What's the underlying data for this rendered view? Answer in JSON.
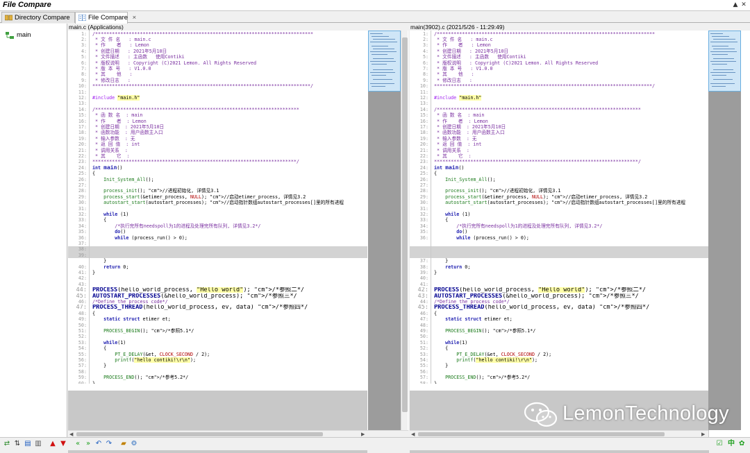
{
  "app": {
    "title": "File Compare"
  },
  "tabs": [
    {
      "label": "Directory Compare",
      "active": false
    },
    {
      "label": "File Compare",
      "active": true,
      "close": "×"
    }
  ],
  "tree": {
    "root_label": "main"
  },
  "left_pane": {
    "header": "main.c (Applications)"
  },
  "right_pane": {
    "header": "main(3902).c (2021/5/26 - 11:29:49)"
  },
  "watermark": {
    "text": "LemonTechnology"
  },
  "status": {
    "lang_left": "中",
    "lang_right": "✿"
  },
  "colors": {
    "keyword": "#1f1fb0",
    "comment": "#7a2fa0",
    "string_bg": "#ffffa8",
    "changed_row": "#d3d3d3"
  },
  "icons": [
    "directory-compare-icon",
    "file-compare-icon",
    "folder-tree-icon",
    "swap-icon",
    "sync-icon",
    "copy-left-icon",
    "copy-right-icon",
    "prev-diff-icon",
    "next-diff-icon",
    "first-diff-icon",
    "last-diff-icon",
    "undo-icon",
    "redo-icon",
    "open-folder-icon",
    "settings-icon"
  ],
  "left_lines": [
    {
      "n": "1",
      "t": "/******************************************************************************",
      "c": "cm"
    },
    {
      "n": "2",
      "t": " * 文 件 名   : main.c",
      "c": "cm"
    },
    {
      "n": "3",
      "t": " * 作    者   : Lemon",
      "c": "cm"
    },
    {
      "n": "4",
      "t": " * 创建日期   : 2021年5月10日",
      "c": "cm"
    },
    {
      "n": "5",
      "t": " * 文件描述   : 主函数   使用Contiki",
      "c": "cm"
    },
    {
      "n": "6",
      "t": " * 版权说明   : Copyright (C)2021 Lemon. All Rights Reserved",
      "c": "cm"
    },
    {
      "n": "7",
      "t": " * 版 本 号   : V1.0.0",
      "c": "cm"
    },
    {
      "n": "8",
      "t": " * 其    他   :",
      "c": "cm"
    },
    {
      "n": "9",
      "t": " * 修改日志   :",
      "c": "cm"
    },
    {
      "n": "10",
      "t": "******************************************************************************/",
      "c": "cm"
    },
    {
      "n": "11",
      "t": "",
      "c": ""
    },
    {
      "n": "12",
      "t": "#include \"main.h\"",
      "c": "inc"
    },
    {
      "n": "13",
      "t": "",
      "c": ""
    },
    {
      "n": "14",
      "t": "/*************************************************************************",
      "c": "cm"
    },
    {
      "n": "15",
      "t": " * 函 数 名  : main",
      "c": "cm"
    },
    {
      "n": "16",
      "t": " * 作    者  : Lemon",
      "c": "cm"
    },
    {
      "n": "17",
      "t": " * 创建日期  : 2021年5月10日",
      "c": "cm"
    },
    {
      "n": "18",
      "t": " * 函数功能  : 用户函数主入口",
      "c": "cm"
    },
    {
      "n": "19",
      "t": " * 输入参数  : 无",
      "c": "cm"
    },
    {
      "n": "20",
      "t": " * 返 回 值  : int",
      "c": "cm"
    },
    {
      "n": "21",
      "t": " * 调用关系  :",
      "c": "cm"
    },
    {
      "n": "22",
      "t": " * 其    它  :",
      "c": "cm"
    },
    {
      "n": "23",
      "t": "*************************************************************************/",
      "c": "cm"
    },
    {
      "n": "24",
      "t": "int main()",
      "c": "main"
    },
    {
      "n": "25",
      "t": "{",
      "c": ""
    },
    {
      "n": "26",
      "t": "    Init_System_All();",
      "c": "call"
    },
    {
      "n": "27",
      "t": "",
      "c": ""
    },
    {
      "n": "28",
      "t": "    process_init(); //进程初始化, 详情见3.1",
      "c": "call"
    },
    {
      "n": "29",
      "t": "    process_start(&etimer_process, NULL); //启动etimer_process, 详情见3.2",
      "c": "call"
    },
    {
      "n": "30",
      "t": "    autostart_start(autostart_processes); //启动指针数组autostart_processes[]里的所有进程",
      "c": "call"
    },
    {
      "n": "31",
      "t": "",
      "c": ""
    },
    {
      "n": "32",
      "t": "    while (1)",
      "c": "kw"
    },
    {
      "n": "33",
      "t": "    {",
      "c": ""
    },
    {
      "n": "34",
      "t": "        /*执行完所有needspoll为1的进程及处理完所有队列, 详情见3.2*/",
      "c": "cm"
    },
    {
      "n": "35",
      "t": "        do()",
      "c": "kw"
    },
    {
      "n": "36",
      "t": "        while (process_run() > 0);",
      "c": "kw"
    },
    {
      "n": "37",
      "t": "",
      "c": ""
    },
    {
      "n": "38",
      "t": "",
      "c": "empty"
    },
    {
      "n": "39",
      "t": "",
      "c": "empty"
    },
    {
      "n": "",
      "t": "    }",
      "c": ""
    },
    {
      "n": "40",
      "t": "    return 0;",
      "c": "kw"
    },
    {
      "n": "41",
      "t": "}",
      "c": ""
    },
    {
      "n": "42",
      "t": "",
      "c": ""
    },
    {
      "n": "43",
      "t": "",
      "c": ""
    },
    {
      "n": "44",
      "t": "PROCESS(hello_world_process, \"Hello world\"); /*参照二*/",
      "c": "big"
    },
    {
      "n": "45",
      "t": "AUTOSTART_PROCESSES(&hello_world_process); /*参照三*/",
      "c": "big"
    },
    {
      "n": "46",
      "t": "/*Define the process code*/",
      "c": "cm"
    },
    {
      "n": "47",
      "t": "PROCESS_THREAD(hello_world_process, ev, data) /*参照四*/",
      "c": "big"
    },
    {
      "n": "48",
      "t": "{",
      "c": ""
    },
    {
      "n": "49",
      "t": "    static struct etimer et;",
      "c": "kw"
    },
    {
      "n": "50",
      "t": "",
      "c": ""
    },
    {
      "n": "51",
      "t": "    PROCESS_BEGIN(); /*参照5.1*/",
      "c": "call"
    },
    {
      "n": "52",
      "t": "",
      "c": ""
    },
    {
      "n": "53",
      "t": "    while(1)",
      "c": "kw"
    },
    {
      "n": "54",
      "t": "    {",
      "c": ""
    },
    {
      "n": "55",
      "t": "        PT_E_DELAY(&et, CLOCK_SECOND / 2);",
      "c": "call"
    },
    {
      "n": "56",
      "t": "        printf(\"hello contiki!\\r\\n\");",
      "c": "call"
    },
    {
      "n": "57",
      "t": "    }",
      "c": ""
    },
    {
      "n": "58",
      "t": "",
      "c": ""
    },
    {
      "n": "59",
      "t": "    PROCESS_END(); /*参考5.2*/",
      "c": "call"
    },
    {
      "n": "60",
      "t": "}",
      "c": ""
    }
  ],
  "right_lines": [
    {
      "n": "1",
      "t": "/******************************************************************************",
      "c": "cm"
    },
    {
      "n": "2",
      "t": " * 文 件 名   : main.c",
      "c": "cm"
    },
    {
      "n": "3",
      "t": " * 作    者   : Lemon",
      "c": "cm"
    },
    {
      "n": "4",
      "t": " * 创建日期   : 2021年5月10日",
      "c": "cm"
    },
    {
      "n": "5",
      "t": " * 文件描述   : 主函数   使用Contiki",
      "c": "cm"
    },
    {
      "n": "6",
      "t": " * 版权说明   : Copyright (C)2021 Lemon. All Rights Reserved",
      "c": "cm"
    },
    {
      "n": "7",
      "t": " * 版 本 号   : V1.0.0",
      "c": "cm"
    },
    {
      "n": "8",
      "t": " * 其    他   :",
      "c": "cm"
    },
    {
      "n": "9",
      "t": " * 修改日志   :",
      "c": "cm"
    },
    {
      "n": "10",
      "t": "******************************************************************************/",
      "c": "cm"
    },
    {
      "n": "11",
      "t": "",
      "c": ""
    },
    {
      "n": "12",
      "t": "#include \"main.h\"",
      "c": "inc"
    },
    {
      "n": "13",
      "t": "",
      "c": ""
    },
    {
      "n": "14",
      "t": "/*************************************************************************",
      "c": "cm"
    },
    {
      "n": "15",
      "t": " * 函 数 名  : main",
      "c": "cm"
    },
    {
      "n": "16",
      "t": " * 作    者  : Lemon",
      "c": "cm"
    },
    {
      "n": "17",
      "t": " * 创建日期  : 2021年5月10日",
      "c": "cm"
    },
    {
      "n": "18",
      "t": " * 函数功能  : 用户函数主入口",
      "c": "cm"
    },
    {
      "n": "19",
      "t": " * 输入参数  : 无",
      "c": "cm"
    },
    {
      "n": "20",
      "t": " * 返 回 值  : int",
      "c": "cm"
    },
    {
      "n": "21",
      "t": " * 调用关系  :",
      "c": "cm"
    },
    {
      "n": "22",
      "t": " * 其    它  :",
      "c": "cm"
    },
    {
      "n": "23",
      "t": "*************************************************************************/",
      "c": "cm"
    },
    {
      "n": "24",
      "t": "int main()",
      "c": "main"
    },
    {
      "n": "25",
      "t": "{",
      "c": ""
    },
    {
      "n": "26",
      "t": "    Init_System_All();",
      "c": "call"
    },
    {
      "n": "27",
      "t": "",
      "c": ""
    },
    {
      "n": "28",
      "t": "    process_init(); //进程初始化, 详情见3.1",
      "c": "call"
    },
    {
      "n": "29",
      "t": "    process_start(&etimer_process, NULL); //启动etimer_process, 详情见3.2",
      "c": "call"
    },
    {
      "n": "30",
      "t": "    autostart_start(autostart_processes); //启动指针数组autostart_processes[]里的所有进程",
      "c": "call"
    },
    {
      "n": "31",
      "t": "",
      "c": ""
    },
    {
      "n": "32",
      "t": "    while (1)",
      "c": "kw"
    },
    {
      "n": "33",
      "t": "    {",
      "c": ""
    },
    {
      "n": "34",
      "t": "        /*执行完所有needspoll为1的进程及处理完所有队列, 详情见3.2*/",
      "c": "cm"
    },
    {
      "n": "35",
      "t": "        do()",
      "c": "kw"
    },
    {
      "n": "36",
      "t": "        while (process_run() > 0);",
      "c": "kw"
    },
    {
      "n": "",
      "t": "",
      "c": ""
    },
    {
      "n": "",
      "t": "",
      "c": "empty"
    },
    {
      "n": "",
      "t": "",
      "c": "empty"
    },
    {
      "n": "37",
      "t": "    }",
      "c": ""
    },
    {
      "n": "38",
      "t": "    return 0;",
      "c": "kw"
    },
    {
      "n": "39",
      "t": "}",
      "c": ""
    },
    {
      "n": "40",
      "t": "",
      "c": ""
    },
    {
      "n": "41",
      "t": "",
      "c": ""
    },
    {
      "n": "42",
      "t": "PROCESS(hello_world_process, \"Hello world\"); /*参照二*/",
      "c": "big"
    },
    {
      "n": "43",
      "t": "AUTOSTART_PROCESSES(&hello_world_process); /*参照三*/",
      "c": "big"
    },
    {
      "n": "44",
      "t": "/*Define the process code*/",
      "c": "cm"
    },
    {
      "n": "45",
      "t": "PROCESS_THREAD(hello_world_process, ev, data) /*参照四*/",
      "c": "big"
    },
    {
      "n": "46",
      "t": "{",
      "c": ""
    },
    {
      "n": "47",
      "t": "    static struct etimer et;",
      "c": "kw"
    },
    {
      "n": "48",
      "t": "",
      "c": ""
    },
    {
      "n": "49",
      "t": "    PROCESS_BEGIN(); /*参照5.1*/",
      "c": "call"
    },
    {
      "n": "50",
      "t": "",
      "c": ""
    },
    {
      "n": "51",
      "t": "    while(1)",
      "c": "kw"
    },
    {
      "n": "52",
      "t": "    {",
      "c": ""
    },
    {
      "n": "53",
      "t": "        PT_E_DELAY(&et, CLOCK_SECOND / 2);",
      "c": "call"
    },
    {
      "n": "54",
      "t": "        printf(\"hello contiki!\\r\\n\");",
      "c": "call"
    },
    {
      "n": "55",
      "t": "    }",
      "c": ""
    },
    {
      "n": "56",
      "t": "",
      "c": ""
    },
    {
      "n": "57",
      "t": "    PROCESS_END(); /*参考5.2*/",
      "c": "call"
    },
    {
      "n": "58",
      "t": "}",
      "c": ""
    }
  ]
}
